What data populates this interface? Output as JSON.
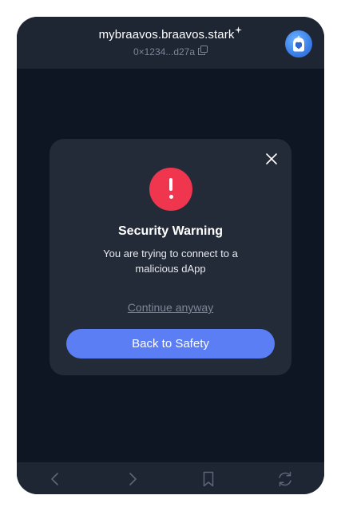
{
  "header": {
    "domain": "mybraavos.braavos.stark",
    "address": "0×1234...d27a",
    "sparkle_icon": "sparkle-icon",
    "copy_icon": "copy-icon",
    "avatar_icon": "braavos-helmet-icon"
  },
  "modal": {
    "title": "Security Warning",
    "message": "You are trying to connect to a malicious dApp",
    "continue_label": "Continue anyway",
    "primary_label": "Back to Safety",
    "close_icon": "close-icon",
    "alert_icon": "exclamation-icon"
  },
  "bottom_nav": {
    "items": [
      "back-icon",
      "forward-icon",
      "bookmark-icon",
      "refresh-icon"
    ]
  },
  "colors": {
    "background": "#0f1623",
    "surface": "#1e2533",
    "modal": "#242b38",
    "accent": "#5b7ef5",
    "danger": "#f0364f",
    "muted": "#7d8597"
  }
}
